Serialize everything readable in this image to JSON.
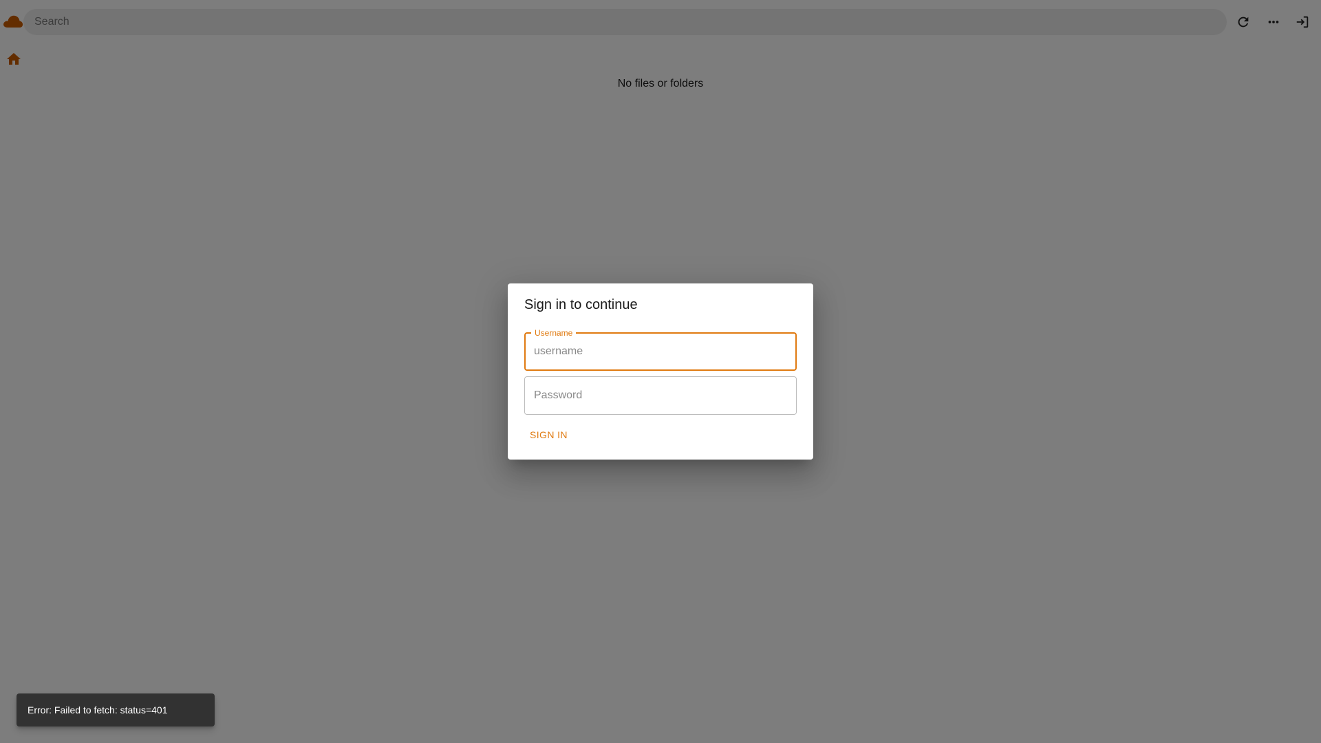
{
  "header": {
    "logo_icon": "cloud-icon",
    "search_placeholder": "Search",
    "search_value": "",
    "actions": [
      {
        "name": "refresh-icon"
      },
      {
        "name": "more-horizontal-icon"
      },
      {
        "name": "login-icon"
      }
    ]
  },
  "breadcrumb": {
    "home_icon": "home-icon"
  },
  "main": {
    "empty_message": "No files or folders"
  },
  "dialog": {
    "title": "Sign in to continue",
    "username": {
      "label": "Username",
      "placeholder": "username",
      "value": ""
    },
    "password": {
      "placeholder": "Password",
      "value": ""
    },
    "submit_label": "SIGN IN"
  },
  "snackbar": {
    "message": "Error: Failed to fetch: status=401"
  },
  "colors": {
    "accent": "#e07a10",
    "brand_logo": "#c65a00",
    "overlay": "rgba(0,0,0,0.5)",
    "snackbar_bg": "#323232"
  }
}
